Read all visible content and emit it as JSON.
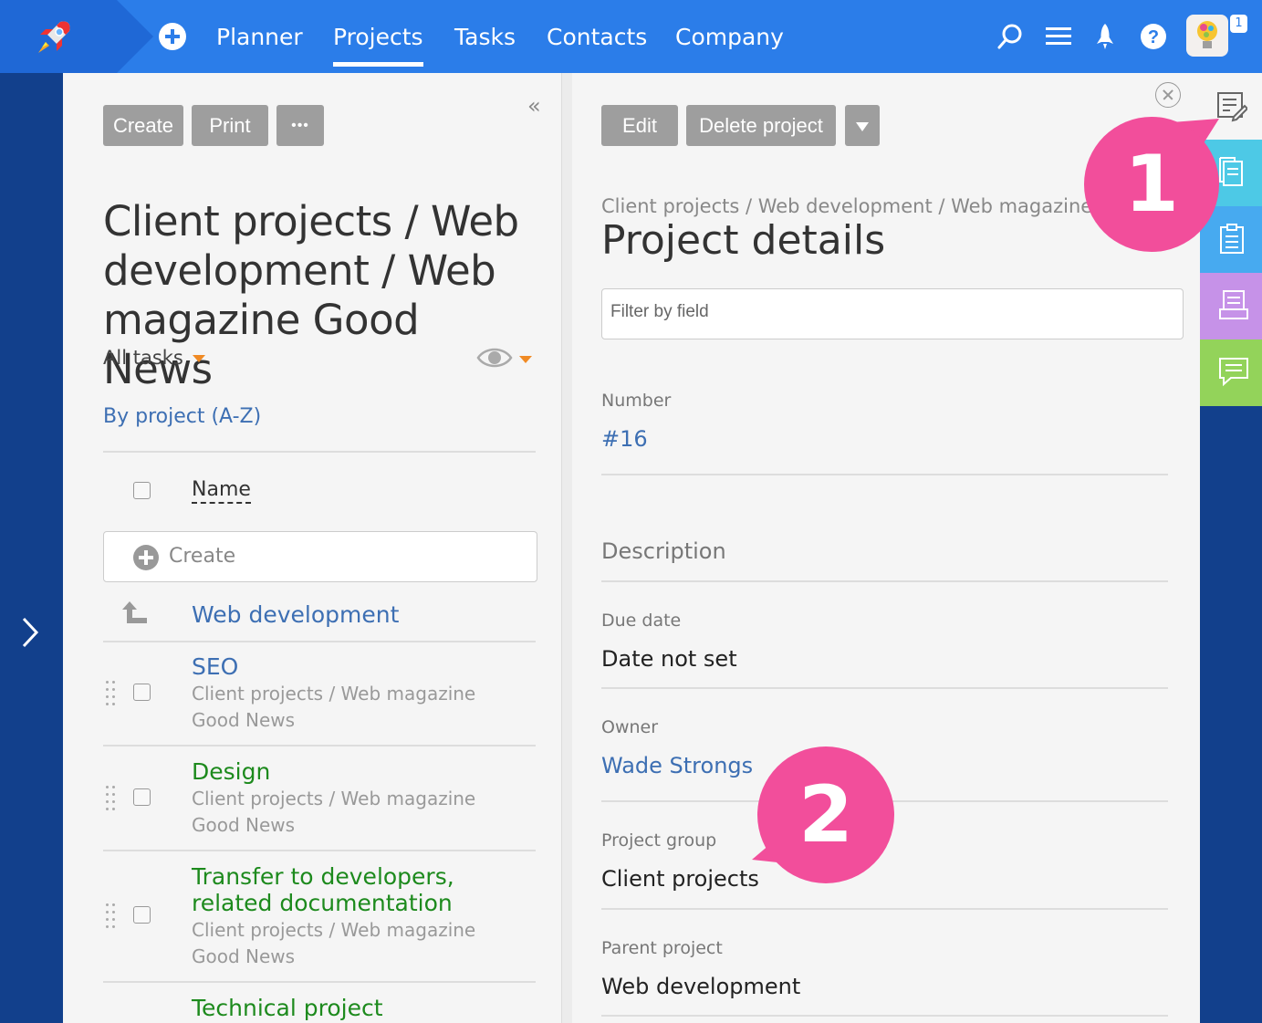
{
  "topbar": {
    "nav": [
      "Planner",
      "Projects",
      "Tasks",
      "Contacts",
      "Company"
    ],
    "active_index": 1,
    "notification_count": "1"
  },
  "left": {
    "buttons": {
      "create": "Create",
      "print": "Print",
      "more": "•••"
    },
    "title": "Client projects / Web development / Web magazine Good News",
    "filter": "All tasks",
    "sort": "By project (A-Z)",
    "column_name": "Name",
    "create_placeholder": "Create",
    "parent": "Web development",
    "tasks": [
      {
        "title": "SEO",
        "sub": "Client projects / Web magazine Good News",
        "color": "#3d6fb3"
      },
      {
        "title": "Design",
        "sub": "Client projects / Web magazine Good News",
        "color": "#1d8a1d"
      },
      {
        "title": "Transfer to developers, related documentation",
        "sub": "Client projects / Web magazine Good News",
        "color": "#1d8a1d"
      },
      {
        "title": "Technical project",
        "sub": "",
        "color": "#1d8a1d"
      }
    ]
  },
  "right": {
    "buttons": {
      "edit": "Edit",
      "delete": "Delete project"
    },
    "breadcrumb": "Client projects / Web development / Web magazine",
    "title": "Project details",
    "filter_placeholder": "Filter by field",
    "fields": {
      "number_label": "Number",
      "number_value": "#16",
      "description_label": "Description",
      "due_label": "Due date",
      "due_value": "Date not set",
      "owner_label": "Owner",
      "owner_value": "Wade Strongs",
      "group_label": "Project group",
      "group_value": "Client projects",
      "parent_label": "Parent project",
      "parent_value": "Web development"
    }
  },
  "callouts": [
    "1",
    "2"
  ],
  "colors": {
    "topbar": "#2b7de9",
    "sidebar": "#12408c",
    "callout": "#f24e9b",
    "tab_teal": "#4dc9e6",
    "tab_blue": "#47aaf0",
    "tab_purple": "#c692e8",
    "tab_green": "#93d35a"
  }
}
